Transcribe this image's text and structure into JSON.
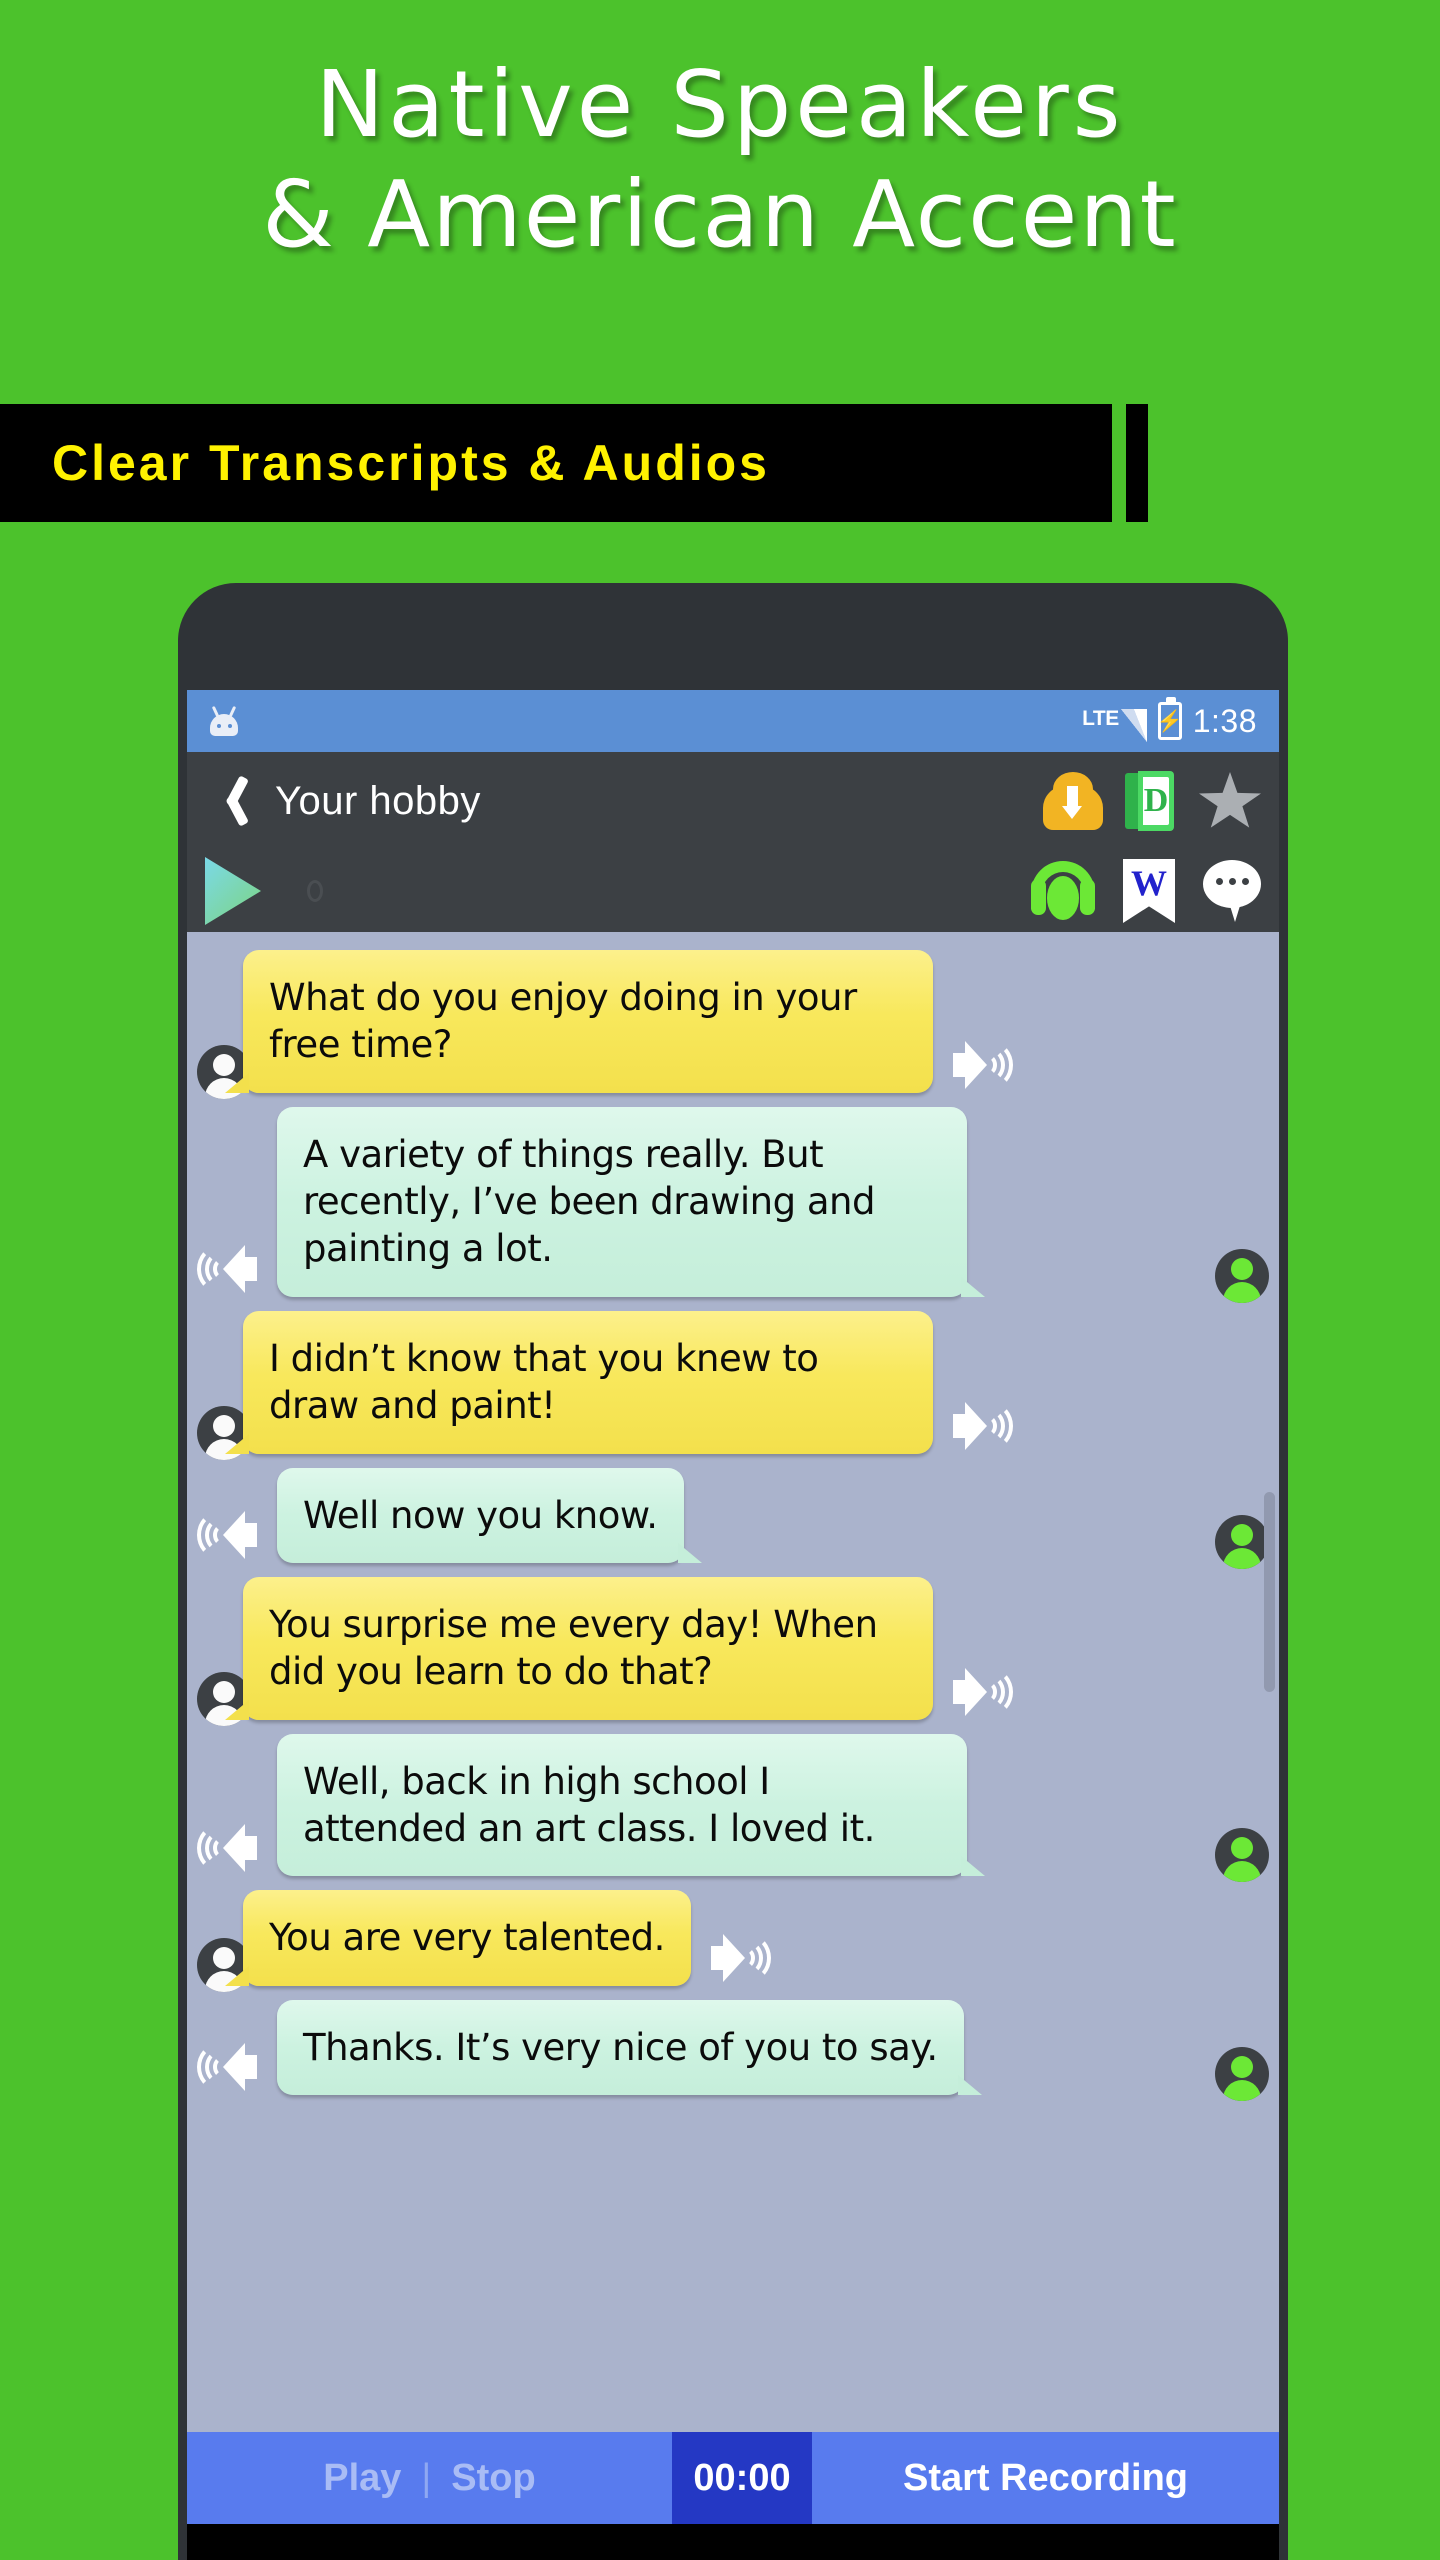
{
  "promo": {
    "headline_line1": "Native Speakers",
    "headline_line2": "& American Accent",
    "banner_text": "Clear Transcripts & Audios",
    "colors": {
      "background_green": "#4CC22C",
      "banner_background": "#000000",
      "banner_text_yellow": "#FFF200",
      "headline_white": "#FFFFFF"
    }
  },
  "phone": {
    "status_bar": {
      "time": "1:38",
      "network_label": "LTE",
      "android_icon": "android-robot-icon",
      "signal_icon": "signal-bars-icon",
      "battery_icon": "battery-charging-icon",
      "background_color": "#5B8FD4"
    },
    "title_bar": {
      "back_icon": "back-chevron-icon",
      "title": "Your hobby",
      "actions": [
        {
          "name": "download-cloud-icon",
          "label": "Download"
        },
        {
          "name": "dictionary-book-icon",
          "label": "D"
        },
        {
          "name": "favorite-star-icon",
          "label": "Favorite"
        }
      ]
    },
    "toolbar": {
      "play_icon": "play-triangle-icon",
      "seek_handle": "seek-handle-icon",
      "actions": [
        {
          "name": "headphones-icon",
          "label": "Listen"
        },
        {
          "name": "bookmark-w-icon",
          "label": "W"
        },
        {
          "name": "chat-bubble-icon",
          "label": "Comments"
        }
      ]
    },
    "chat": {
      "background_color": "#AAB3CC",
      "messages": [
        {
          "side": "left",
          "text": "What do you enjoy doing in your free time?",
          "bubble_color": "#F8E85C",
          "avatar": "white-person-avatar",
          "speaker_icon": "speaker-icon"
        },
        {
          "side": "right",
          "text": "A variety of things really. But recently, I’ve been drawing and painting a lot.",
          "bubble_color": "#CCF2E0",
          "avatar": "green-person-avatar",
          "speaker_icon": "speaker-icon"
        },
        {
          "side": "left",
          "text": "I didn’t know that you knew to draw and paint!",
          "bubble_color": "#F8E85C",
          "avatar": "white-person-avatar",
          "speaker_icon": "speaker-icon"
        },
        {
          "side": "right",
          "text": "Well now you know.",
          "bubble_color": "#CCF2E0",
          "avatar": "green-person-avatar",
          "speaker_icon": "speaker-icon"
        },
        {
          "side": "left",
          "text": "You surprise me every day! When did you learn to do that?",
          "bubble_color": "#F8E85C",
          "avatar": "white-person-avatar",
          "speaker_icon": "speaker-icon"
        },
        {
          "side": "right",
          "text": "Well, back in high school I attended an art class. I loved it.",
          "bubble_color": "#CCF2E0",
          "avatar": "green-person-avatar",
          "speaker_icon": "speaker-icon"
        },
        {
          "side": "left",
          "text": "You are very talented.",
          "bubble_color": "#F8E85C",
          "avatar": "white-person-avatar",
          "speaker_icon": "speaker-icon"
        },
        {
          "side": "right",
          "text": "Thanks. It’s very nice of you to say.",
          "bubble_color": "#CCF2E0",
          "avatar": "green-person-avatar",
          "speaker_icon": "speaker-icon"
        }
      ]
    },
    "bottom_bar": {
      "play_label": "Play",
      "separator": "|",
      "stop_label": "Stop",
      "timer": "00:00",
      "record_label": "Start Recording",
      "segment_color": "#587BEE",
      "timer_color": "#2438C4"
    }
  }
}
